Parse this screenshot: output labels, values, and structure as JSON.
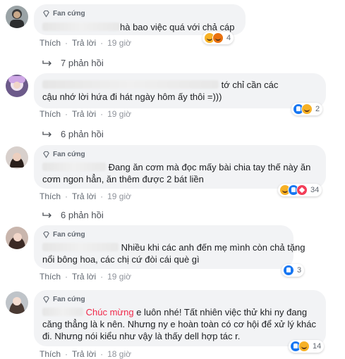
{
  "fan_badge": "Fan cứng",
  "action_like": "Thích",
  "action_reply": "Trả lời",
  "dot": "·",
  "comments": [
    {
      "text_lines": [
        "hà bao việc quá với chả cáp"
      ],
      "time": "19 giờ",
      "reaction_count": "4",
      "replies": "7 phản hồi"
    },
    {
      "text_lines": [
        "tớ chỉ cần các",
        "cậu nhớ lời hứa đi hát ngày hôm ấy thôi =)))"
      ],
      "time": "19 giờ",
      "reaction_count": "2",
      "replies": "6 phản hồi"
    },
    {
      "text_lines": [
        "Đang ăn cơm mà đọc mấy bài chia tay thế này ăn",
        "cơm ngon hẳn, ăn thêm được 2 bát liền"
      ],
      "time": "19 giờ",
      "reaction_count": "34",
      "replies": "6 phản hồi"
    },
    {
      "text_lines": [
        "Nhiều khi các anh đến mẹ mình còn chả tặng",
        "nổi bông hoa, các chị cứ đòi cái què gì"
      ],
      "time": "19 giờ",
      "reaction_count": "3"
    },
    {
      "highlight": "Chúc mừng",
      "text_lines": [
        " e luôn nhé! Tất nhiên việc thử khi ny đang",
        "căng thẳng là k nên. Nhưng ny e hoàn toàn có cơ hội để xử lý khác",
        "đi. Nhưng nói kiểu như vậy là thấy dell hợp tác r."
      ],
      "time": "18 giờ",
      "reaction_count": "14"
    }
  ],
  "colors": {
    "bubble": "#f2f3f5",
    "link": "#606770",
    "highlight": "#f02849"
  }
}
